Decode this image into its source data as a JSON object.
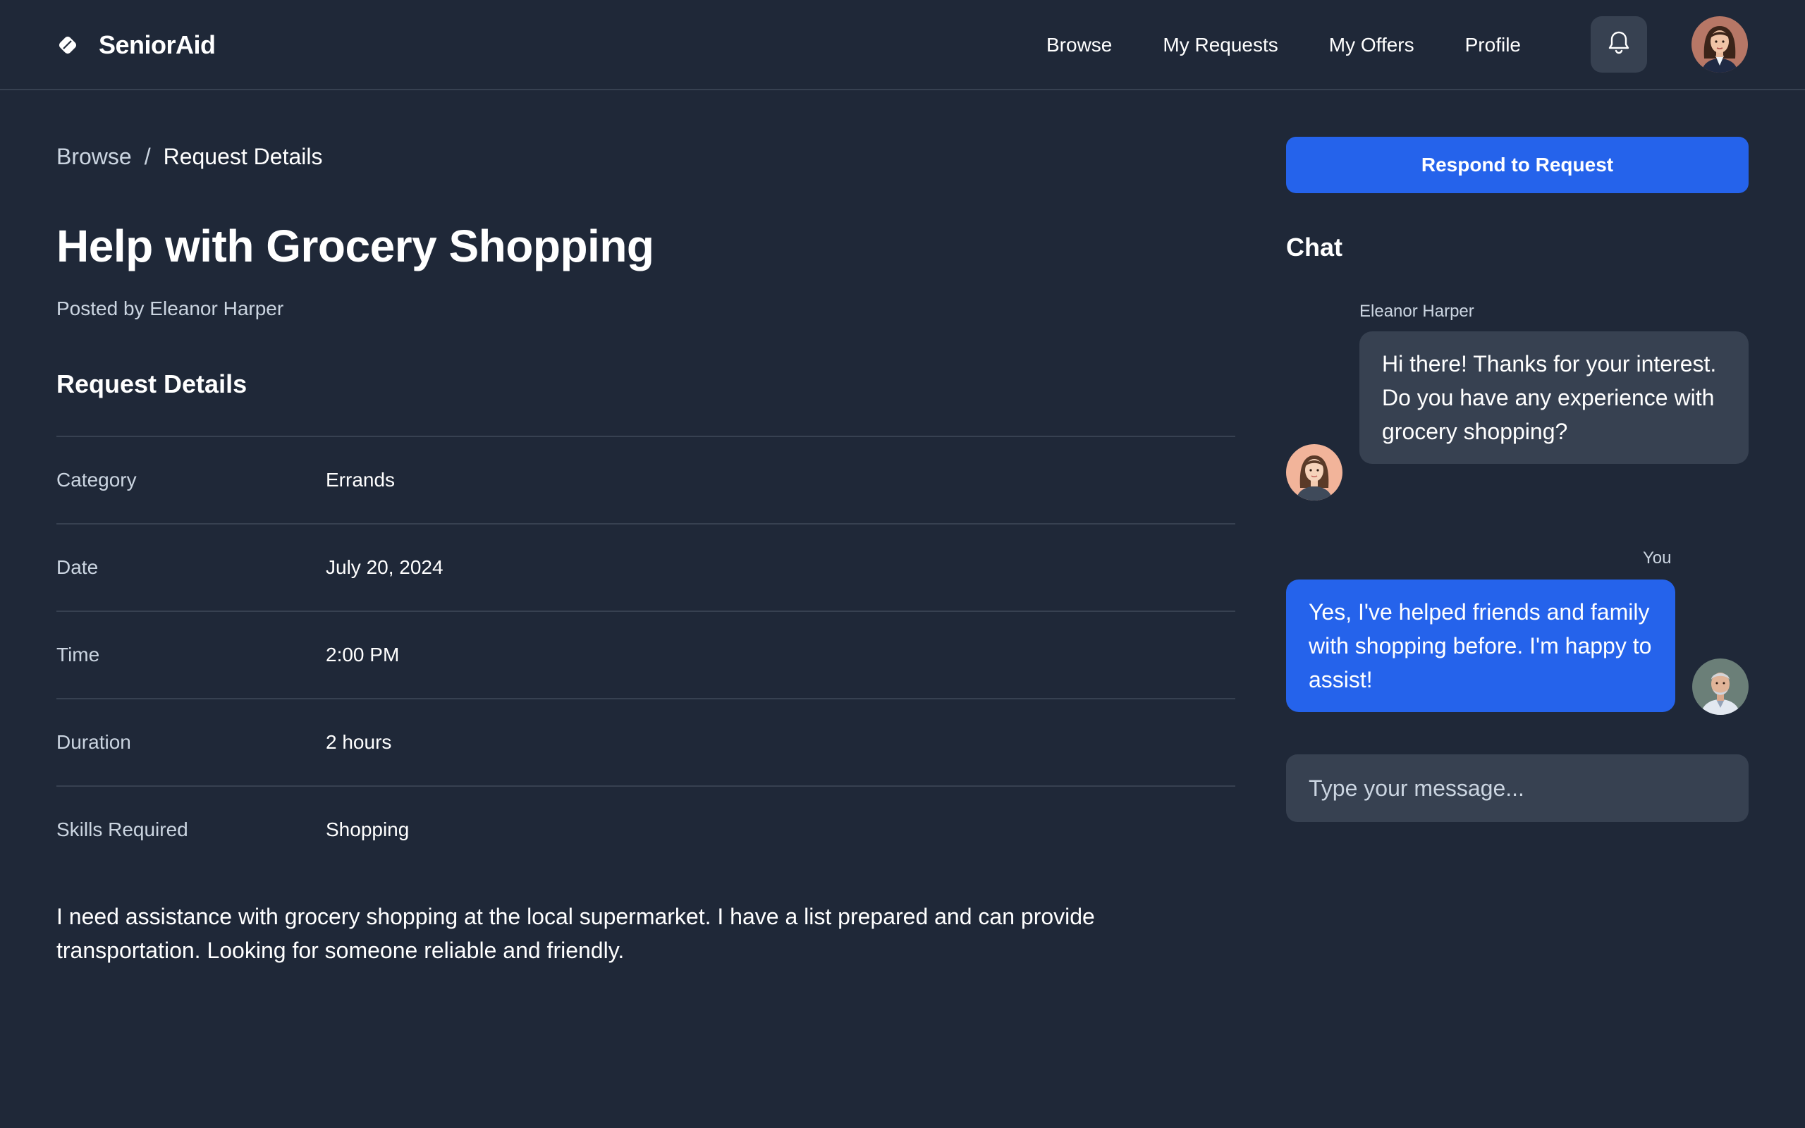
{
  "header": {
    "brand_name": "SeniorAid",
    "nav": [
      {
        "label": "Browse"
      },
      {
        "label": "My Requests"
      },
      {
        "label": "My Offers"
      },
      {
        "label": "Profile"
      }
    ],
    "icons": {
      "brand": "diamond-tag-icon",
      "notifications": "bell-icon",
      "avatar": "user-avatar"
    }
  },
  "breadcrumb": {
    "parent": "Browse",
    "separator": "/",
    "current": "Request Details"
  },
  "request": {
    "title": "Help with Grocery Shopping",
    "posted_by": "Posted by Eleanor Harper",
    "section_title": "Request Details",
    "details": [
      {
        "label": "Category",
        "value": "Errands"
      },
      {
        "label": "Date",
        "value": "July 20, 2024"
      },
      {
        "label": "Time",
        "value": "2:00 PM"
      },
      {
        "label": "Duration",
        "value": "2 hours"
      },
      {
        "label": "Skills Required",
        "value": "Shopping"
      }
    ],
    "description": "I need assistance with grocery shopping at the local supermarket. I have a list prepared and can provide transportation. Looking for someone reliable and friendly."
  },
  "actions": {
    "respond_label": "Respond to Request"
  },
  "chat": {
    "title": "Chat",
    "messages": [
      {
        "sender": "Eleanor Harper",
        "text": "Hi there! Thanks for your interest. Do you have any experience with grocery shopping?"
      },
      {
        "sender": "You",
        "text": "Yes, I've helped friends and family with shopping before. I'm happy to assist!"
      }
    ],
    "input_placeholder": "Type your message..."
  },
  "colors": {
    "background": "#1f2838",
    "surface": "#374151",
    "accent": "#2563eb",
    "muted_text": "#cbd5e1"
  }
}
